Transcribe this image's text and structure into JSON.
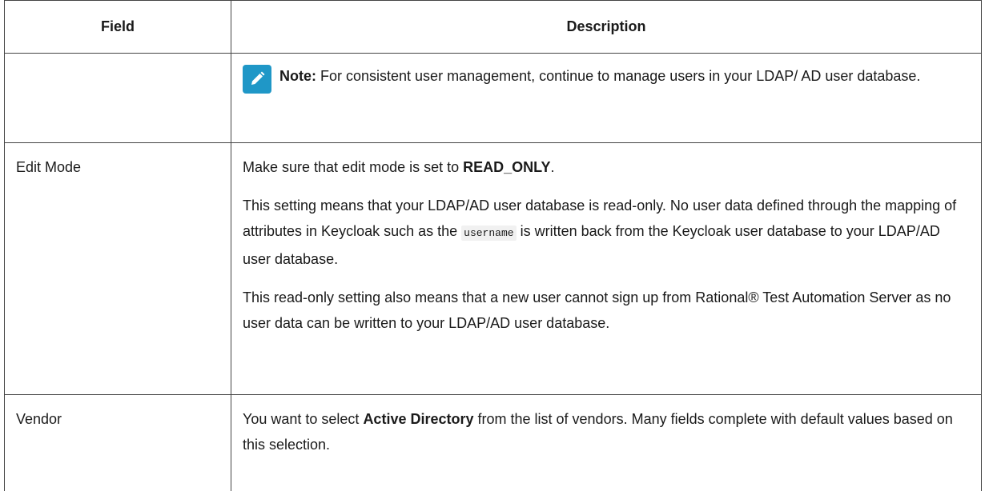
{
  "table": {
    "headers": {
      "field": "Field",
      "description": "Description"
    },
    "note_row": {
      "icon": "pencil-note-icon",
      "icon_color": "#1f97c7",
      "label": "Note:",
      "text": " For consistent user management, continue to manage users in your LDAP/ AD user database."
    },
    "edit_mode": {
      "field": "Edit Mode",
      "p1_pre": "Make sure that edit mode is set to ",
      "p1_bold": "READ_ONLY",
      "p1_post": ".",
      "p2_pre": "This setting means that your LDAP/AD user database is read-only. No user data defined through the mapping of attributes in Keycloak such as the ",
      "p2_code": "username",
      "p2_post": " is written back from the Keycloak user database to your LDAP/AD user database.",
      "p3": "This read-only setting also means that a new user cannot sign up from Rational® Test Automation Server as no user data can be written to your LDAP/AD user database."
    },
    "vendor": {
      "field": "Vendor",
      "p1_pre": "You want to select ",
      "p1_bold": "Active Directory",
      "p1_post": " from the list of vendors. Many fields complete with default values based on this selection."
    }
  }
}
